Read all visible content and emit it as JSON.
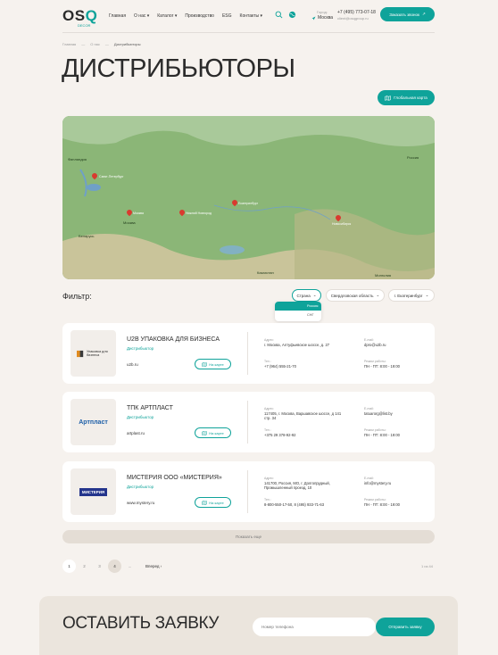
{
  "header": {
    "logo": "OS",
    "logo_q": "Q",
    "logo_sub": "DECOR",
    "nav": [
      "Главная",
      "О нас",
      "Каталог",
      "Производство",
      "ESG",
      "Контакты"
    ],
    "city_label": "Город:",
    "city": "Москва",
    "phone": "+7 (495) 773-07-18",
    "email": "client@osqgroup.ru",
    "call_button": "Заказать звонок"
  },
  "breadcrumb": {
    "home": "Главная",
    "parent": "О нас",
    "current": "Дистрибьюторы"
  },
  "page_title": "ДИСТРИБЬЮТОРЫ",
  "map_button": "Глобальная карта",
  "map": {
    "labels": [
      "Финляндия",
      "Россия",
      "Москва",
      "Беларусь",
      "Казахстан",
      "Монголия"
    ],
    "pins": [
      "Санкт-Петербург",
      "Москва",
      "Нижний Новгород",
      "Екатеринбург",
      "Новосибирск"
    ]
  },
  "filter": {
    "label": "Фильтр:",
    "country": "Страна",
    "region": "Свердловская область",
    "city": "г. Екатеринбург",
    "options": [
      "Россия",
      "СНГ"
    ]
  },
  "distributors": [
    {
      "logo_text": "Упаковка для бизнеса",
      "name": "U2B УПАКОВКА ДЛЯ БИЗНЕСА",
      "type": "Дистрибьютор",
      "site": "u2b.ru",
      "map_btn": "На карте",
      "address_label": "Адрес:",
      "address": "г. Москва, Алтуфьевское шоссе, д. 27",
      "email_label": "E-mail:",
      "email": "dpro@u2b.ru",
      "phone_label": "Тел.:",
      "phone": "+7 (964) 555-21-70",
      "hours_label": "Режим работы:",
      "hours": "ПН - ПТ: 8:00 - 19:00"
    },
    {
      "logo_text": "Артпласт",
      "name": "ТПК АРТПЛАСТ",
      "type": "Дистрибьютор",
      "site": "artplast.ru",
      "map_btn": "На карте",
      "address_label": "Адрес:",
      "address": "117405, г. Москва, Варшавское шоссе, д 141 стр. 34",
      "email_label": "E-mail:",
      "email": "tatuarorg@list.by",
      "phone_label": "Тел.:",
      "phone": "+375 29 378-92-92",
      "hours_label": "Режим работы:",
      "hours": "ПН - ПТ: 8:00 - 19:00"
    },
    {
      "logo_text": "МИСТЕРИЯ",
      "name": "МИСТЕРИЯ ООО «МИСТЕРИЯ»",
      "type": "Дистрибьютор",
      "site": "www.mystery.ru",
      "map_btn": "На карте",
      "address_label": "Адрес:",
      "address": "141700, Россия, МО, г. Долгопрудный, Промышленный проезд, 10",
      "email_label": "E-mail:",
      "email": "info@mystery.ru",
      "phone_label": "Тел.:",
      "phone": "8-800-550-17-50, 8 (495) 933-71-63",
      "hours_label": "Режим работы:",
      "hours": "ПН - ПТ: 8:00 - 19:00"
    }
  ],
  "show_more": "Показать еще",
  "pagination": {
    "pages": [
      "1",
      "2",
      "3",
      "4"
    ],
    "ellipsis": "...",
    "next": "Вперед",
    "count": "1 из 44"
  },
  "form": {
    "title": "ОСТАВИТЬ ЗАЯВКУ",
    "phone_placeholder": "Номер телефона",
    "submit": "Отправить заявку"
  },
  "colors": {
    "accent": "#0fa39a",
    "background": "#f6f2ee"
  }
}
